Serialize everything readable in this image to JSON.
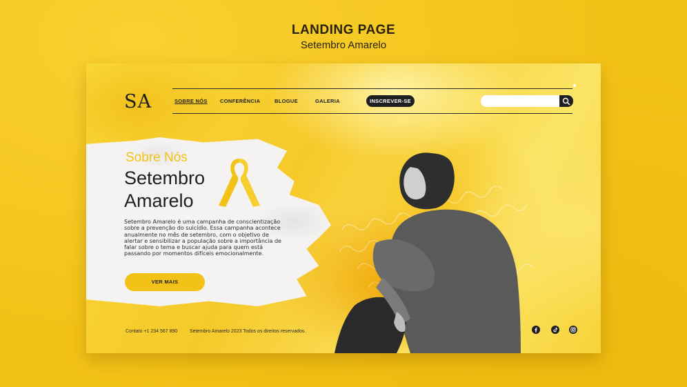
{
  "page": {
    "heading": "LANDING PAGE",
    "subheading": "Setembro Amarelo"
  },
  "header": {
    "logo": "SA",
    "nav": [
      "SOBRE NÓS",
      "CONFERÊNCIA",
      "BLOGUE",
      "GALERIA"
    ],
    "active_nav": "SOBRE NÓS",
    "cta_label": "INSCREVER-SE",
    "search_placeholder": ""
  },
  "hero": {
    "kicker": "Sobre Nós",
    "title_line1": "Setembro",
    "title_line2": "Amarelo",
    "paragraph": "Setembro Amarelo é uma campanha de conscientização sobre a prevenção do suicídio. Essa campanha acontece anualmente no mês de setembro, com o objetivo de alertar e sensibilizar a população sobre a importância de falar sobre o tema e buscar ajuda para quem está passando por momentos difíceis emocionalmente.",
    "button_label": "VER MAIS"
  },
  "footer": {
    "contact": "Contato +1 234 567 890",
    "copyright": "Setembro Amarelo 2023 Todos os direitos reservados.",
    "social_icons": [
      "facebook-icon",
      "tiktok-icon",
      "instagram-icon"
    ]
  },
  "colors": {
    "background": "#f3c217",
    "accent": "#f3c217",
    "dark": "#1f1f1f",
    "panel": "#f4f3f1"
  }
}
